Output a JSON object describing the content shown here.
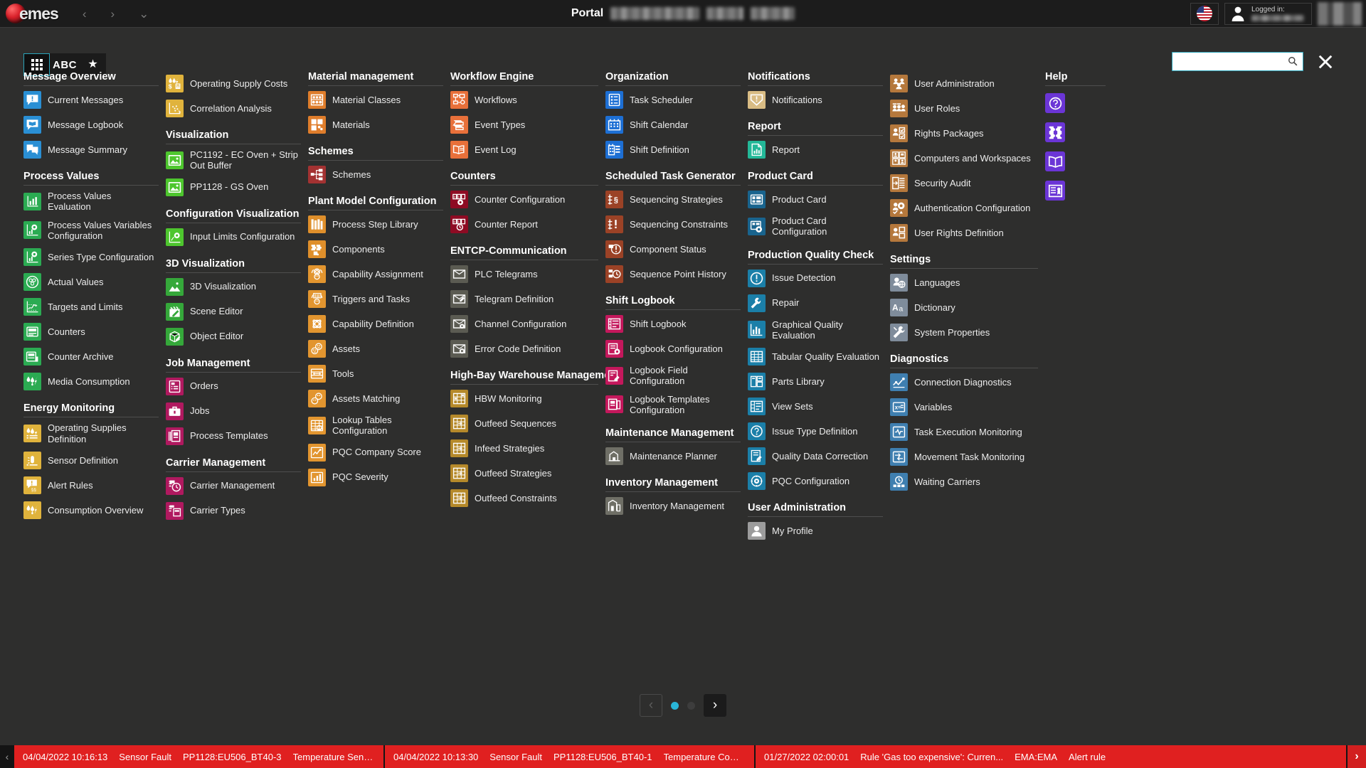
{
  "header": {
    "logo_text": "emes",
    "nav": {
      "back": "‹",
      "forward": "›",
      "dropdown": "⌄"
    },
    "title": "Portal",
    "login_label": "Logged in:",
    "flag_icon": "us-flag-icon"
  },
  "toolbar": {
    "grid_view_label": "grid-view",
    "abc_view_label": "ABC",
    "favorites_label": "★",
    "search_value": "",
    "search_placeholder": "",
    "close_label": "✕"
  },
  "pager": {
    "prev": "‹",
    "next": "›",
    "pages": 2,
    "current": 1
  },
  "help": {
    "title": "Help",
    "icons": [
      "help-question-icon",
      "help-puzzle-icon",
      "help-manual-icon",
      "help-license-icon"
    ]
  },
  "columns": [
    {
      "width": "normal",
      "sections": [
        {
          "title": "Message Overview",
          "items": [
            {
              "label": "Current Messages",
              "icon": "message-alert-icon",
              "color": "#2a8fd4"
            },
            {
              "label": "Message Logbook",
              "icon": "message-book-icon",
              "color": "#2a8fd4"
            },
            {
              "label": "Message Summary",
              "icon": "message-summary-icon",
              "color": "#2a8fd4"
            }
          ]
        },
        {
          "title": "Process Values",
          "items": [
            {
              "label": "Process Values Evaluation",
              "icon": "bar-chart-icon",
              "color": "#2bab52"
            },
            {
              "label": "Process Values Variables Configuration",
              "icon": "chart-gear-icon",
              "color": "#2bab52"
            },
            {
              "label": "Series Type Configuration",
              "icon": "chart-gear-icon",
              "color": "#2bab52"
            },
            {
              "label": "Actual Values",
              "icon": "gauge-icon",
              "color": "#2bab52"
            },
            {
              "label": "Targets and Limits",
              "icon": "limits-chart-icon",
              "color": "#2bab52"
            },
            {
              "label": "Counters",
              "icon": "counter-icon",
              "color": "#2bab52"
            },
            {
              "label": "Counter Archive",
              "icon": "counter-archive-icon",
              "color": "#2bab52"
            },
            {
              "label": "Media Consumption",
              "icon": "media-consumption-icon",
              "color": "#2bab52"
            }
          ]
        },
        {
          "title": "Energy Monitoring",
          "items": [
            {
              "label": "Operating Supplies Definition",
              "icon": "supplies-definition-icon",
              "color": "#e0b33c"
            },
            {
              "label": "Sensor Definition",
              "icon": "sensor-icon",
              "color": "#e0b33c"
            },
            {
              "label": "Alert Rules",
              "icon": "alert-rules-icon",
              "color": "#e0b33c"
            },
            {
              "label": "Consumption Overview",
              "icon": "consumption-icon",
              "color": "#e0b33c"
            }
          ]
        }
      ]
    },
    {
      "width": "normal",
      "sections": [
        {
          "title": "",
          "items": [
            {
              "label": "Operating Supply Costs",
              "icon": "supply-costs-icon",
              "color": "#e0b33c"
            },
            {
              "label": "Correlation Analysis",
              "icon": "correlation-icon",
              "color": "#e0b33c"
            }
          ]
        },
        {
          "title": "Visualization",
          "items": [
            {
              "label": "PC1192 - EC Oven + Strip Out Buffer",
              "icon": "image-icon",
              "color": "#4ec62e"
            },
            {
              "label": "PP1128 - GS Oven",
              "icon": "image-icon",
              "color": "#4ec62e"
            }
          ]
        },
        {
          "title": "Configuration Visualization",
          "items": [
            {
              "label": "Input Limits Configuration",
              "icon": "input-limits-icon",
              "color": "#4ec62e"
            }
          ]
        },
        {
          "title": "3D Visualization",
          "items": [
            {
              "label": "3D Visualization",
              "icon": "landscape-3d-icon",
              "color": "#35a83a"
            },
            {
              "label": "Scene Editor",
              "icon": "scene-editor-icon",
              "color": "#35a83a"
            },
            {
              "label": "Object Editor",
              "icon": "object-editor-icon",
              "color": "#35a83a"
            }
          ]
        },
        {
          "title": "Job Management",
          "items": [
            {
              "label": "Orders",
              "icon": "orders-icon",
              "color": "#b0195f"
            },
            {
              "label": "Jobs",
              "icon": "jobs-briefcase-icon",
              "color": "#b0195f"
            },
            {
              "label": "Process Templates",
              "icon": "process-templates-icon",
              "color": "#b0195f"
            }
          ]
        },
        {
          "title": "Carrier Management",
          "items": [
            {
              "label": "Carrier Management",
              "icon": "carrier-management-icon",
              "color": "#b0195f"
            },
            {
              "label": "Carrier Types",
              "icon": "carrier-types-icon",
              "color": "#b0195f"
            }
          ]
        }
      ]
    },
    {
      "width": "normal",
      "sections": [
        {
          "title": "Material management",
          "items": [
            {
              "label": "Material Classes",
              "icon": "material-classes-icon",
              "color": "#df7d2b"
            },
            {
              "label": "Materials",
              "icon": "materials-icon",
              "color": "#df7d2b"
            }
          ]
        },
        {
          "title": "Schemes",
          "items": [
            {
              "label": "Schemes",
              "icon": "schemes-icon",
              "color": "#a33232"
            }
          ]
        },
        {
          "title": "Plant Model Configuration",
          "items": [
            {
              "label": "Process Step Library",
              "icon": "library-icon",
              "color": "#df8f2b"
            },
            {
              "label": "Components",
              "icon": "components-icon",
              "color": "#df8f2b"
            },
            {
              "label": "Capability Assignment",
              "icon": "capability-assignment-icon",
              "color": "#e2952f"
            },
            {
              "label": "Triggers and Tasks",
              "icon": "triggers-tasks-icon",
              "color": "#e2952f"
            },
            {
              "label": "Capability Definition",
              "icon": "capability-definition-icon",
              "color": "#e2952f"
            },
            {
              "label": "Assets",
              "icon": "assets-icon",
              "color": "#e2952f"
            },
            {
              "label": "Tools",
              "icon": "tools-icon",
              "color": "#e2952f"
            },
            {
              "label": "Assets Matching",
              "icon": "assets-matching-icon",
              "color": "#e2952f"
            },
            {
              "label": "Lookup Tables Configuration",
              "icon": "lookup-tables-icon",
              "color": "#e2952f"
            },
            {
              "label": "PQC Company Score",
              "icon": "pqc-score-icon",
              "color": "#e2952f"
            },
            {
              "label": "PQC Severity",
              "icon": "pqc-severity-icon",
              "color": "#e2952f"
            }
          ]
        }
      ]
    },
    {
      "width": "wide",
      "sections": [
        {
          "title": "Workflow Engine",
          "items": [
            {
              "label": "Workflows",
              "icon": "workflow-icon",
              "color": "#e8703a"
            },
            {
              "label": "Event Types",
              "icon": "event-types-icon",
              "color": "#e8703a"
            },
            {
              "label": "Event Log",
              "icon": "event-log-icon",
              "color": "#e8703a"
            }
          ]
        },
        {
          "title": "Counters",
          "items": [
            {
              "label": "Counter Configuration",
              "icon": "counter-config-icon",
              "color": "#8e0b23"
            },
            {
              "label": "Counter Report",
              "icon": "counter-report-icon",
              "color": "#8e0b23"
            }
          ]
        },
        {
          "title": "ENTCP-Communication",
          "items": [
            {
              "label": "PLC Telegrams",
              "icon": "plc-telegram-icon",
              "color": "#5b5b52"
            },
            {
              "label": "Telegram Definition",
              "icon": "telegram-definition-icon",
              "color": "#5b5b52"
            },
            {
              "label": "Channel Configuration",
              "icon": "channel-config-icon",
              "color": "#5b5b52"
            },
            {
              "label": "Error Code Definition",
              "icon": "error-code-icon",
              "color": "#5b5b52"
            }
          ]
        },
        {
          "title": "High-Bay Warehouse Management",
          "items": [
            {
              "label": "HBW Monitoring",
              "icon": "hbw-monitoring-icon",
              "color": "#b5892a"
            },
            {
              "label": "Outfeed Sequences",
              "icon": "outfeed-sequences-icon",
              "color": "#b5892a"
            },
            {
              "label": "Infeed Strategies",
              "icon": "infeed-strategies-icon",
              "color": "#b5892a"
            },
            {
              "label": "Outfeed Strategies",
              "icon": "outfeed-strategies-icon",
              "color": "#b5892a"
            },
            {
              "label": "Outfeed Constraints",
              "icon": "outfeed-constraints-icon",
              "color": "#b5892a"
            }
          ]
        }
      ]
    },
    {
      "width": "normal",
      "sections": [
        {
          "title": "Organization",
          "items": [
            {
              "label": "Task Scheduler",
              "icon": "task-scheduler-icon",
              "color": "#1d6fd4"
            },
            {
              "label": "Shift Calendar",
              "icon": "shift-calendar-icon",
              "color": "#1d6fd4"
            },
            {
              "label": "Shift Definition",
              "icon": "shift-definition-icon",
              "color": "#1d6fd4"
            }
          ]
        },
        {
          "title": "Scheduled Task Generator",
          "items": [
            {
              "label": "Sequencing Strategies",
              "icon": "sequencing-strategies-icon",
              "color": "#9b4226"
            },
            {
              "label": "Sequencing Constraints",
              "icon": "sequencing-constraints-icon",
              "color": "#9b4226"
            },
            {
              "label": "Component Status",
              "icon": "component-status-icon",
              "color": "#9b4226"
            },
            {
              "label": "Sequence Point History",
              "icon": "sequence-history-icon",
              "color": "#9b4226"
            }
          ]
        },
        {
          "title": "Shift Logbook",
          "items": [
            {
              "label": "Shift Logbook",
              "icon": "shift-logbook-icon",
              "color": "#c4185c"
            },
            {
              "label": "Logbook Configuration",
              "icon": "logbook-config-icon",
              "color": "#c4185c"
            },
            {
              "label": "Logbook Field Configuration",
              "icon": "logbook-field-icon",
              "color": "#c4185c"
            },
            {
              "label": "Logbook Templates Configuration",
              "icon": "logbook-templates-icon",
              "color": "#c4185c"
            }
          ]
        },
        {
          "title": "Maintenance Management",
          "items": [
            {
              "label": "Maintenance Planner",
              "icon": "maintenance-planner-icon",
              "color": "#6f6f66"
            }
          ]
        },
        {
          "title": "Inventory Management",
          "items": [
            {
              "label": "Inventory Management",
              "icon": "inventory-icon",
              "color": "#6f6f66"
            }
          ]
        }
      ]
    },
    {
      "width": "normal",
      "sections": [
        {
          "title": "Notifications",
          "items": [
            {
              "label": "Notifications",
              "icon": "notification-envelope-icon",
              "color": "#d9bc84"
            }
          ]
        },
        {
          "title": "Report",
          "items": [
            {
              "label": "Report",
              "icon": "report-icon",
              "color": "#23b898"
            }
          ]
        },
        {
          "title": "Product Card",
          "items": [
            {
              "label": "Product Card",
              "icon": "product-card-icon",
              "color": "#19648e"
            },
            {
              "label": "Product Card Configuration",
              "icon": "product-card-config-icon",
              "color": "#19648e"
            }
          ]
        },
        {
          "title": "Production Quality Check",
          "items": [
            {
              "label": "Issue Detection",
              "icon": "issue-detection-icon",
              "color": "#1b7fa8"
            },
            {
              "label": "Repair",
              "icon": "repair-icon",
              "color": "#1b7fa8"
            },
            {
              "label": "Graphical Quality Evaluation",
              "icon": "graphical-quality-icon",
              "color": "#1b7fa8"
            },
            {
              "label": "Tabular Quality Evaluation",
              "icon": "tabular-quality-icon",
              "color": "#1b7fa8"
            },
            {
              "label": "Parts Library",
              "icon": "parts-library-icon",
              "color": "#1b7fa8"
            },
            {
              "label": "View Sets",
              "icon": "view-sets-icon",
              "color": "#1b7fa8"
            },
            {
              "label": "Issue Type Definition",
              "icon": "issue-type-icon",
              "color": "#1b7fa8"
            },
            {
              "label": "Quality Data Correction",
              "icon": "quality-correction-icon",
              "color": "#1b7fa8"
            },
            {
              "label": "PQC Configuration",
              "icon": "pqc-configuration-icon",
              "color": "#1b7fa8"
            }
          ]
        },
        {
          "title": "User Administration",
          "items": [
            {
              "label": "My Profile",
              "icon": "my-profile-icon",
              "color": "#9c9c9c"
            }
          ]
        }
      ]
    },
    {
      "width": "wide",
      "sections": [
        {
          "title": "",
          "items": [
            {
              "label": "User Administration",
              "icon": "user-administration-icon",
              "color": "#b5783c"
            },
            {
              "label": "User Roles",
              "icon": "user-roles-icon",
              "color": "#b5783c"
            },
            {
              "label": "Rights Packages",
              "icon": "rights-packages-icon",
              "color": "#b5783c"
            },
            {
              "label": "Computers and Workspaces",
              "icon": "computers-workspaces-icon",
              "color": "#b5783c"
            },
            {
              "label": "Security Audit",
              "icon": "security-audit-icon",
              "color": "#b5783c"
            },
            {
              "label": "Authentication Configuration",
              "icon": "authentication-config-icon",
              "color": "#b5783c"
            },
            {
              "label": "User Rights Definition",
              "icon": "user-rights-icon",
              "color": "#b5783c"
            }
          ]
        },
        {
          "title": "Settings",
          "items": [
            {
              "label": "Languages",
              "icon": "languages-icon",
              "color": "#7f8c9b"
            },
            {
              "label": "Dictionary",
              "icon": "dictionary-icon",
              "color": "#7f8c9b"
            },
            {
              "label": "System Properties",
              "icon": "system-properties-icon",
              "color": "#7f8c9b"
            }
          ]
        },
        {
          "title": "Diagnostics",
          "items": [
            {
              "label": "Connection Diagnostics",
              "icon": "connection-diagnostics-icon",
              "color": "#3f7fb0"
            },
            {
              "label": "Variables",
              "icon": "variables-icon",
              "color": "#3f7fb0"
            },
            {
              "label": "Task Execution Monitoring",
              "icon": "task-execution-icon",
              "color": "#3f7fb0"
            },
            {
              "label": "Movement Task Monitoring",
              "icon": "movement-task-icon",
              "color": "#3f7fb0"
            },
            {
              "label": "Waiting Carriers",
              "icon": "waiting-carriers-icon",
              "color": "#3f7fb0"
            }
          ]
        }
      ]
    }
  ],
  "ticker": {
    "prev": "‹",
    "next": "›",
    "messages": [
      {
        "time": "04/04/2022 10:16:13",
        "type": "Sensor Fault",
        "source": "PP1128:EU506_BT40-3",
        "text": "Temperature Sensor Oven Exh..."
      },
      {
        "time": "04/04/2022 10:13:30",
        "type": "Sensor Fault",
        "source": "PP1128:EU506_BT40-1",
        "text": "Temperature Combustion Cha..."
      },
      {
        "time": "01/27/2022 02:00:01",
        "type": "Rule 'Gas too expensive': Curren...",
        "source": "EMA:EMA",
        "text": "Alert rule"
      }
    ]
  }
}
